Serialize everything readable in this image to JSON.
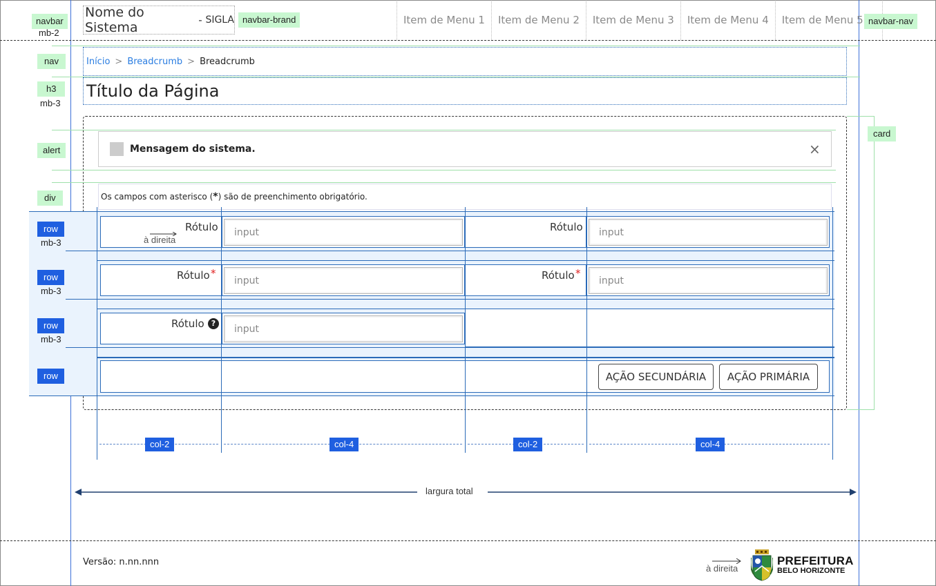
{
  "navbar": {
    "tag": "navbar",
    "spacing": "mb-2",
    "brand_name": "Nome do Sistema",
    "brand_sep": " - ",
    "brand_sigla": "SIGLA",
    "brand_tag": "navbar-brand",
    "nav_tag": "navbar-nav",
    "menu": [
      "Item de Menu 1",
      "Item de Menu 2",
      "Item de Menu 3",
      "Item de Menu 4",
      "Item de Menu 5"
    ]
  },
  "breadcrumb": {
    "tag": "nav",
    "items": [
      "Início",
      "Breadcrumb",
      "Breadcrumb"
    ],
    "sep": ">"
  },
  "title": {
    "tag": "h3",
    "spacing": "mb-3",
    "text": "Título da Página"
  },
  "card": {
    "tag": "card"
  },
  "alert": {
    "tag": "alert",
    "message": "Mensagem do sistema.",
    "close": "×"
  },
  "div_block": {
    "tag": "div",
    "text_before": "Os campos com asterisco (",
    "asterisk": "*",
    "text_after": ") são de preenchimento obrigatório."
  },
  "rows": {
    "tag": "row",
    "spacing": "mb-3",
    "label": "Rótulo",
    "right_note": "à direita",
    "input_placeholder": "input",
    "required_mark": "*",
    "help_icon": "?"
  },
  "actions": {
    "secondary": "AÇÃO SECUNDÁRIA",
    "primary": "AÇÃO PRIMÁRIA"
  },
  "columns": [
    "col-2",
    "col-4",
    "col-2",
    "col-4"
  ],
  "width_label": "largura total",
  "footer": {
    "version": "Versão: n.nn.nnn",
    "right_note": "à direita",
    "logo_line1": "PREFEITURA",
    "logo_line2": "BELO HORIZONTE"
  },
  "colors": {
    "accent_blue": "#1f5fe0",
    "tag_green": "#c8f7d0",
    "required_red": "#e02020",
    "row_bg": "#eaf3fd"
  }
}
